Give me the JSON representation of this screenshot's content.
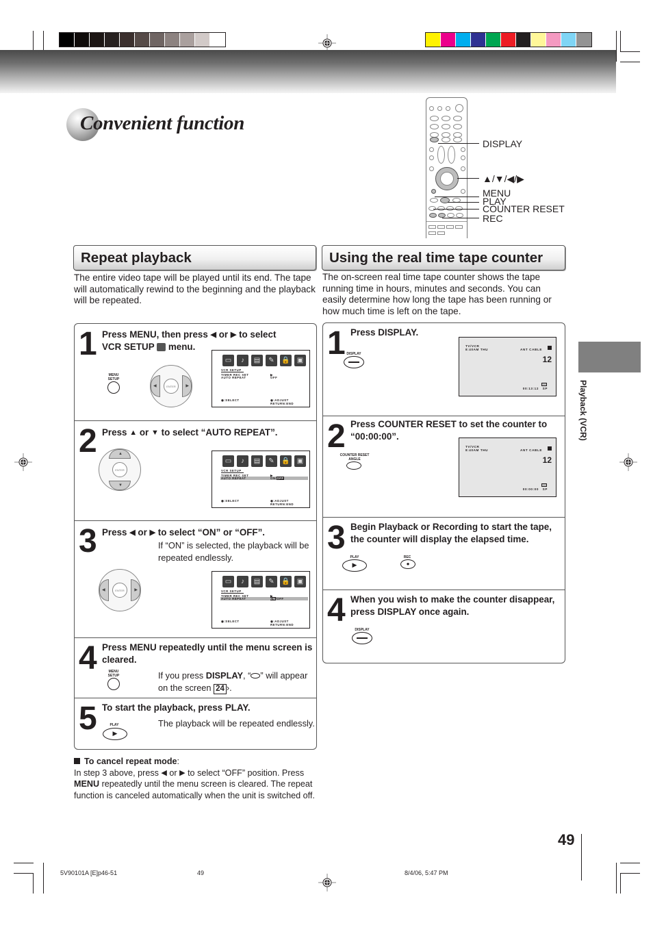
{
  "print_marks": {
    "gray_swatches": [
      "#000000",
      "#0f0b0a",
      "#1c1614",
      "#272120",
      "#3b302e",
      "#564b48",
      "#6f6563",
      "#8c8280",
      "#aaa09e",
      "#d2cac8",
      "#ffffff"
    ],
    "color_swatches": [
      "#fff200",
      "#ec008c",
      "#00aeef",
      "#2e3192",
      "#00a651",
      "#ed1c24",
      "#231f20",
      "#fff799",
      "#f49ac1",
      "#7fd5f5",
      "#939393"
    ]
  },
  "page": {
    "title": "Convenient function",
    "side_tab_label": "Playback (VCR)",
    "page_number": "49"
  },
  "remote": {
    "callouts": [
      "DISPLAY",
      "▲/▼/◀/▶",
      "MENU",
      "PLAY",
      "COUNTER RESET",
      "REC"
    ]
  },
  "repeat_playback": {
    "heading": "Repeat playback",
    "intro": "The entire video tape will be played until its end. The tape will automatically rewind to the beginning and the playback will be repeated.",
    "steps": [
      {
        "number": "1",
        "title_a": "Press MENU, then press",
        "title_or": "or",
        "title_b": "to select",
        "title_c": "VCR SETUP",
        "title_d": "menu.",
        "key_label": "MENU\nSETUP"
      },
      {
        "number": "2",
        "title_a": "Press",
        "title_or": "or",
        "title_b": "to select “AUTO REPEAT”."
      },
      {
        "number": "3",
        "title_a": "Press",
        "title_or": "or",
        "title_b": "to select “ON” or “OFF”.",
        "text": "If “ON” is selected, the playback will be repeated endlessly."
      },
      {
        "number": "4",
        "title": "Press MENU repeatedly until the menu screen is cleared.",
        "key_label": "MENU\nSETUP",
        "text_a": "If you press",
        "text_bold": "DISPLAY",
        "text_b": ", “",
        "text_c": "” will appear on the screen",
        "ref_page": "24",
        "text_d": "."
      },
      {
        "number": "5",
        "title": "To start the playback, press PLAY.",
        "key_label": "PLAY",
        "text": "The playback will be repeated endlessly."
      }
    ],
    "osd": {
      "menu_title": "VCR SETUP",
      "item1": "TIMER REC SET",
      "item2": "AUTO REPEAT",
      "value_off": "OFF",
      "value_onoff": "ON/OFF",
      "select_hint": ":SELECT",
      "adjust_hint": ":ADJUST",
      "return_hint": "RETURN:END",
      "icons": [
        "picture-icon",
        "audio-icon",
        "channel-icon",
        "setup-wrench-icon",
        "lock-icon",
        "vcr-setup-icon"
      ]
    },
    "cancel": {
      "heading": "To cancel repeat mode",
      "text_a": "In step 3 above, press",
      "text_or": "or",
      "text_b": "to select “OFF” position. Press",
      "text_bold": "MENU",
      "text_c": "repeatedly until the menu screen is cleared. The repeat function is canceled automatically when the unit is switched off."
    }
  },
  "tape_counter": {
    "heading": "Using the real time tape counter",
    "intro": "The on-screen real time tape counter shows the tape running time in hours, minutes and seconds. You can easily determine how long the tape has been running or how much time is left on the tape.",
    "steps": [
      {
        "number": "1",
        "title": "Press DISPLAY.",
        "key_label": "DISPLAY"
      },
      {
        "number": "2",
        "title": "Press COUNTER RESET to set the counter to “00:00:00”.",
        "key_label": "COUNTER RESET\nANGLE"
      },
      {
        "number": "3",
        "title": "Begin Playback or Recording to start the tape, the counter will display the elapsed time.",
        "key_play": "PLAY",
        "key_rec": "REC"
      },
      {
        "number": "4",
        "title": "When you wish to make the counter disappear, press DISPLAY once again.",
        "key_label": "DISPLAY"
      }
    ],
    "screens": [
      {
        "mode": "TV/VCR",
        "time": "8:40AM THU",
        "source": "ANT CABLE",
        "channel": "12",
        "counter": "00:13:12",
        "speed": "SP"
      },
      {
        "mode": "TV/VCR",
        "time": "8:40AM THU",
        "source": "ANT CABLE",
        "channel": "12",
        "counter": "00:00:00",
        "speed": "SP"
      }
    ]
  },
  "footer": {
    "file": "5V90101A [E]p46-51",
    "page": "49",
    "date": "8/4/06, 5:47 PM"
  }
}
